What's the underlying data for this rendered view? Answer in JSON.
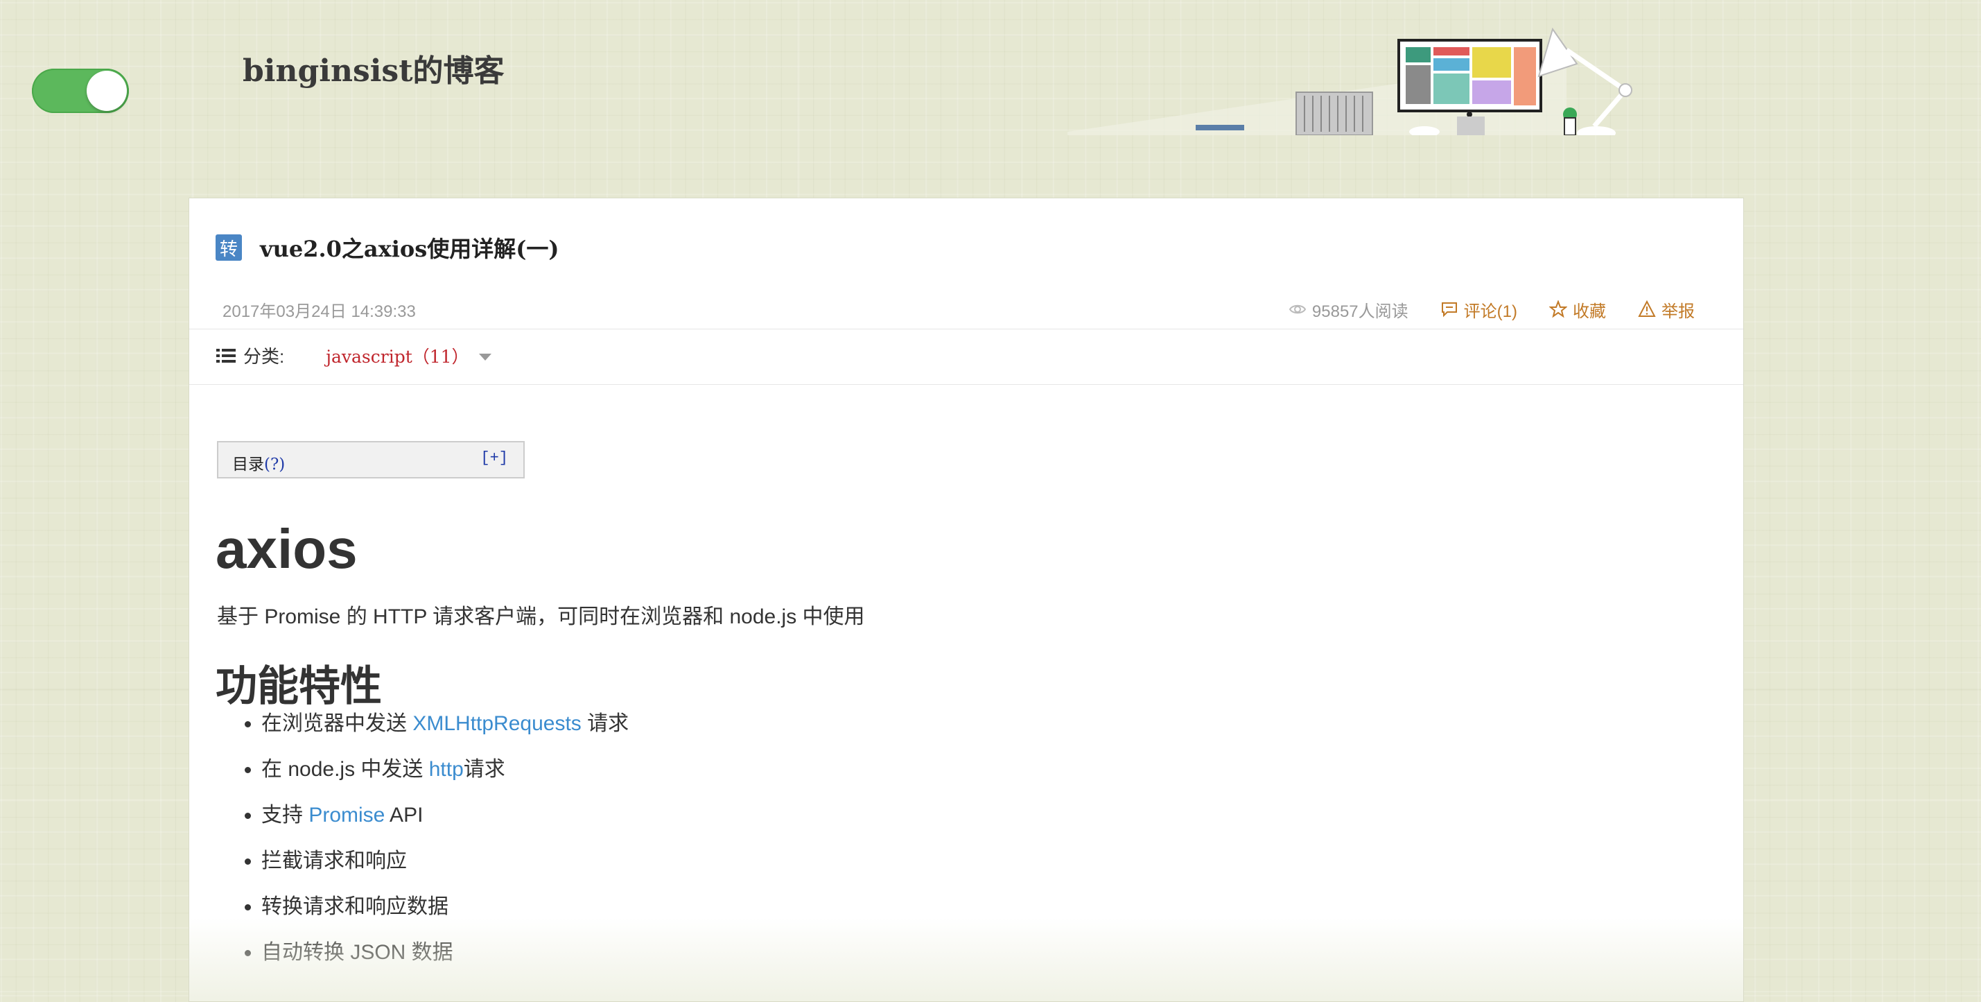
{
  "blog": {
    "title": "binginsist的博客"
  },
  "header": {
    "theme_toggle": "on"
  },
  "article": {
    "repost_badge": "转",
    "title": "vue2.0之axios使用详解(一)",
    "date": "2017年03月24日 14:39:33",
    "views": "95857人阅读",
    "comments": "评论(1)",
    "favorite": "收藏",
    "report": "举报",
    "category_label": "分类:",
    "category_value": "javascript（11）",
    "toc": {
      "label": "目录",
      "help": "(?)",
      "toggle": "[+]"
    },
    "heading": "axios",
    "intro": "基于 Promise 的 HTTP 请求客户端，可同时在浏览器和 node.js 中使用",
    "features_heading": "功能特性",
    "features": [
      {
        "before": "在浏览器中发送 ",
        "link": "XMLHttpRequests",
        "after": " 请求"
      },
      {
        "before": "在 node.js 中发送 ",
        "link": "http",
        "after": "请求"
      },
      {
        "before": "支持 ",
        "link": "Promise",
        "after": " API"
      },
      {
        "before": "拦截请求和响应",
        "link": "",
        "after": ""
      },
      {
        "before": "转换请求和响应数据",
        "link": "",
        "after": ""
      },
      {
        "before": "自动转换 JSON 数据",
        "link": "",
        "after": ""
      }
    ]
  },
  "icons": {
    "views": "eye-icon",
    "comments": "comment-icon",
    "favorite": "star-icon",
    "report": "warning-icon",
    "category": "list-icon"
  },
  "colors": {
    "accent_orange": "#c27a27",
    "link_blue": "#3b8ccf",
    "category_red": "#c0262d",
    "toggle_green": "#5cb85c",
    "badge_blue": "#4a86c5"
  }
}
